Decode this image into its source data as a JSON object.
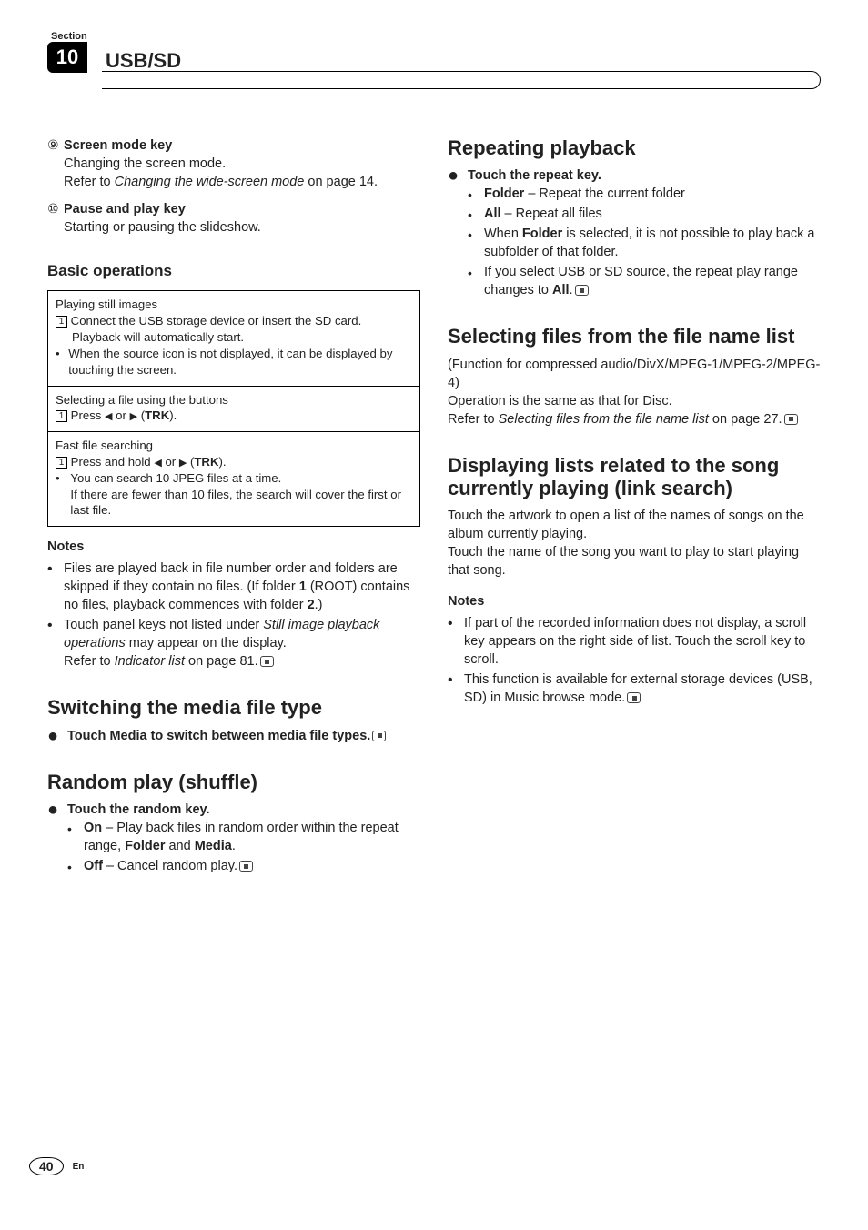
{
  "header": {
    "section_label": "Section",
    "section_num": "10",
    "title": "USB/SD"
  },
  "left": {
    "i9": {
      "circ": "⑨",
      "title": "Screen mode key",
      "l1": "Changing the screen mode.",
      "l2a": "Refer to ",
      "l2i": "Changing the wide-screen mode",
      "l2b": " on page 14."
    },
    "i10": {
      "circ": "⑩",
      "title": "Pause and play key",
      "l1": "Starting or pausing the slideshow."
    },
    "h_basic": "Basic operations",
    "box1": {
      "t": "Playing still images",
      "s": "1",
      "l1": "Connect the USB storage device or insert the SD card.",
      "l2": "Playback will automatically start.",
      "b1": "When the source icon is not displayed, it can be displayed by touching the screen."
    },
    "box2": {
      "t": "Selecting a file using the buttons",
      "s": "1",
      "l1a": "Press ",
      "c": "◀",
      "or": " or ",
      "d": "▶",
      "l1b": " (",
      "l1c": "TRK",
      "l1d": ")."
    },
    "box3": {
      "t": "Fast file searching",
      "s": "1",
      "l1a": "Press and hold ",
      "c": "◀",
      "or": " or ",
      "d": "▶",
      "l1b": " (",
      "l1c": "TRK",
      "l1d": ").",
      "b1": "You can search 10 JPEG files at a time."
    },
    "box3b2": "If there are fewer than 10 files, the search will cover the first or last file.",
    "notes_h": "Notes",
    "n1a": "Files are played back in file number order and folders are skipped if they contain no files. (If folder ",
    "n1b": "1",
    "n1c": " (ROOT) contains no files, playback commences with folder ",
    "n1d": "2",
    "n1e": ".)",
    "n2a": "Touch panel keys not listed under ",
    "n2i": "Still image playback operations",
    "n2b": " may appear on the display.",
    "n2c": "Refer to ",
    "n2ci": "Indicator list",
    "n2d": " on page 81.",
    "h_switch": "Switching the media file type",
    "sw_a": "Touch Media to switch between media file types.",
    "h_random": "Random play (shuffle)",
    "rp_lead": "Touch the random key.",
    "rp1a": "On",
    "rp1b": " – Play back files in random order within the repeat range, ",
    "rp1c": "Folder",
    "rp1d": " and ",
    "rp1e": "Media",
    "rp1f": ".",
    "rp2a": "Off",
    "rp2b": " – Cancel random play."
  },
  "right": {
    "h_repeat": "Repeating playback",
    "rp_lead": "Touch the repeat key.",
    "r1a": "Folder",
    "r1b": " – Repeat the current folder",
    "r2a": "All",
    "r2b": " – Repeat all files",
    "r3a": "When ",
    "r3b": "Folder",
    "r3c": " is selected, it is not possible to play back a subfolder of that folder.",
    "r4a": "If you select USB or SD source, the repeat play range changes to ",
    "r4b": "All",
    "r4c": ".",
    "h_select": "Selecting files from the file name list",
    "s1": "(Function for compressed audio/DivX/MPEG-1/MPEG-2/MPEG-4)",
    "s2": "Operation is the same as that for Disc.",
    "s3a": "Refer to ",
    "s3i": "Selecting files from the file name list",
    "s3b": " on page 27.",
    "h_disp": "Displaying lists related to the song currently playing (link search)",
    "d1": "Touch the artwork to open a list of the names of songs on the album currently playing.",
    "d2": "Touch the name of the song you want to play to start playing that song.",
    "notes_h": "Notes",
    "dn1": "If part of the recorded information does not display, a scroll key appears on the right side of list. Touch the scroll key to scroll.",
    "dn2": "This function is available for external storage devices (USB, SD) in Music browse mode."
  },
  "footer": {
    "page": "40",
    "lang": "En"
  }
}
